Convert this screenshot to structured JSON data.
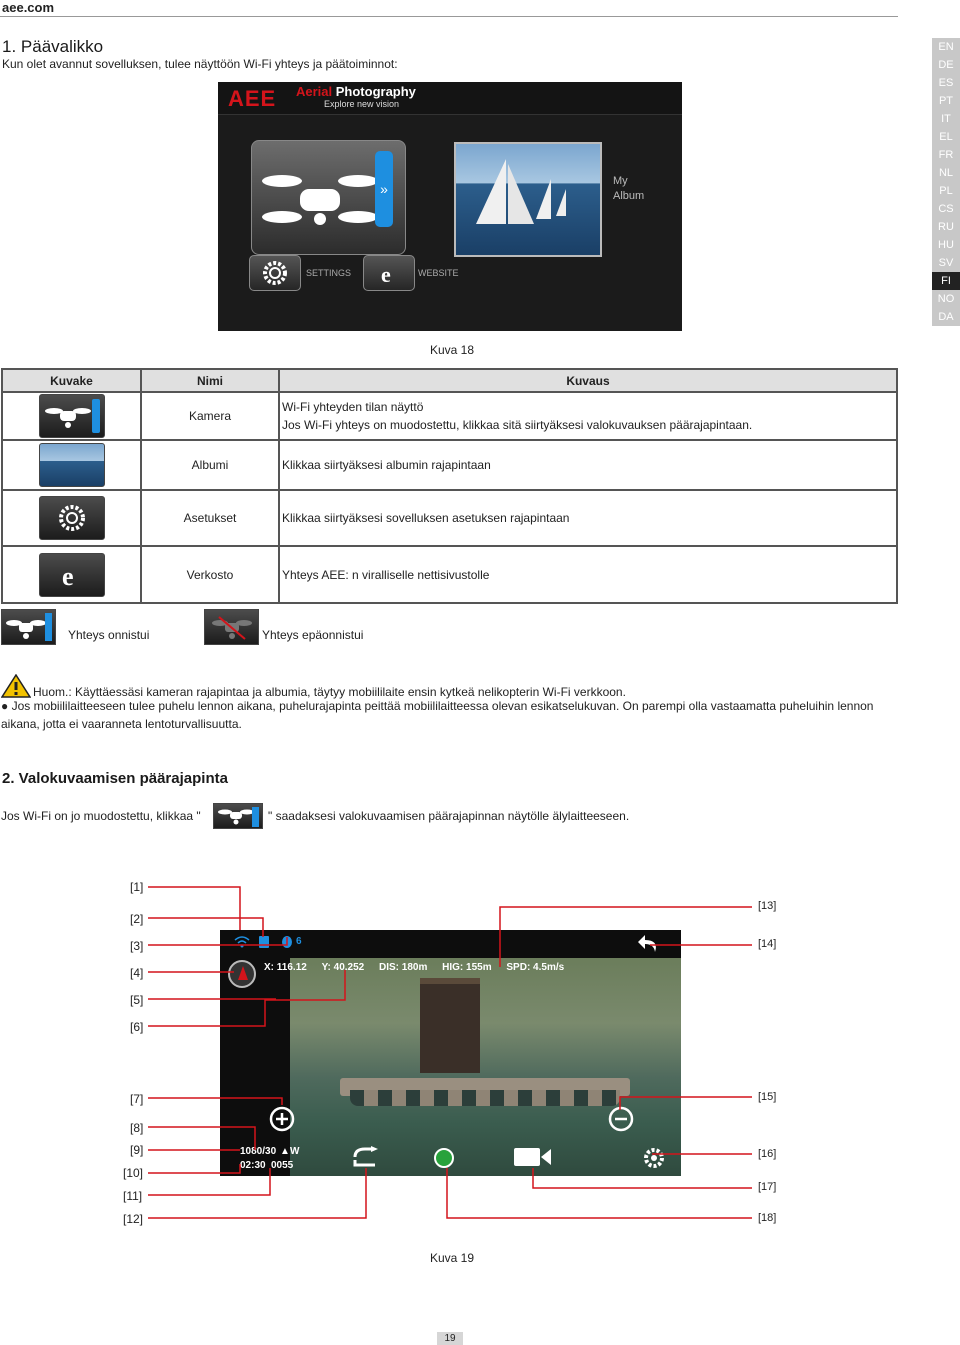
{
  "brand": "aee.com",
  "languages": [
    "EN",
    "DE",
    "ES",
    "PT",
    "IT",
    "EL",
    "FR",
    "NL",
    "PL",
    "CS",
    "RU",
    "HU",
    "SV",
    "FI",
    "NO",
    "DA"
  ],
  "active_language": "FI",
  "section1": {
    "title": "1. Päävalikko",
    "intro": "Kun olet avannut sovelluksen, tulee näyttöön Wi-Fi yhteys ja päätoiminnot:"
  },
  "app1": {
    "logo": "AEE",
    "logo_title_a": "Aerial",
    "logo_title_b": " Photography",
    "logo_tagline": "Explore new vision",
    "album_label_1": "My",
    "album_label_2": "Album",
    "settings_label": "SETTINGS",
    "website_label": "WEBSITE"
  },
  "figure18": "Kuva  18",
  "table": {
    "headers": [
      "Kuvake",
      "Nimi",
      "Kuvaus"
    ],
    "rows": [
      {
        "name": "Kamera",
        "desc1": "Wi-Fi yhteyden tilan näyttö",
        "desc2": "Jos Wi-Fi yhteys on muodostettu, klikkaa sitä siirtyäksesi valokuvauksen päärajapintaan."
      },
      {
        "name": "Albumi",
        "desc1": "Klikkaa siirtyäksesi albumin rajapintaan"
      },
      {
        "name": "Asetukset",
        "desc1": "Klikkaa siirtyäksesi sovelluksen asetuksen rajapintaan"
      },
      {
        "name": "Verkosto",
        "desc1": "Yhteys AEE: n viralliselle nettisivustolle"
      }
    ]
  },
  "status": {
    "ok": "Yhteys onnistui",
    "fail": "Yhteys epäonnistui"
  },
  "note": {
    "line1": "Huom.: Käyttäessäsi kameran rajapintaa ja albumia, täytyy mobiililaite ensin kytkeä nelikopterin Wi-Fi verkkoon.",
    "line2": "●  Jos mobiililaitteeseen tulee puhelu lennon aikana, puhelurajapinta peittää mobiililaitteessa olevan esikatselukuvan. On parempi olla vastaamatta puheluihin lennon",
    "line3": "aikana, jotta ei vaaranneta lentoturvallisuutta."
  },
  "section2": {
    "title": "2. Valokuvaamisen päärajapinta",
    "intro_a": "Jos Wi-Fi on jo muodostettu, klikkaa \"",
    "intro_b": "\" saadaksesi valokuvaamisen päärajapinnan näytölle älylaitteeseen."
  },
  "app2": {
    "battery_count": "6",
    "tel_x": "X: 116.12",
    "tel_y": "Y: 40.252",
    "tel_dis": "DIS: 180m",
    "tel_hig": "HIG: 155m",
    "tel_spd": "SPD: 4.5m/s",
    "resolution": "1080/30",
    "wb": "W",
    "rec_time": "02:30",
    "shots": "0055"
  },
  "callouts_left": [
    "[1]",
    "[2]",
    "[3]",
    "[4]",
    "[5]",
    "[6]",
    "[7]",
    "[8]",
    "[9]",
    "[10]",
    "[11]",
    "[12]"
  ],
  "callouts_right": [
    "[13]",
    "[14]",
    "[15]",
    "[16]",
    "[17]",
    "[18]"
  ],
  "figure19": "Kuva  19",
  "page_number": "19"
}
